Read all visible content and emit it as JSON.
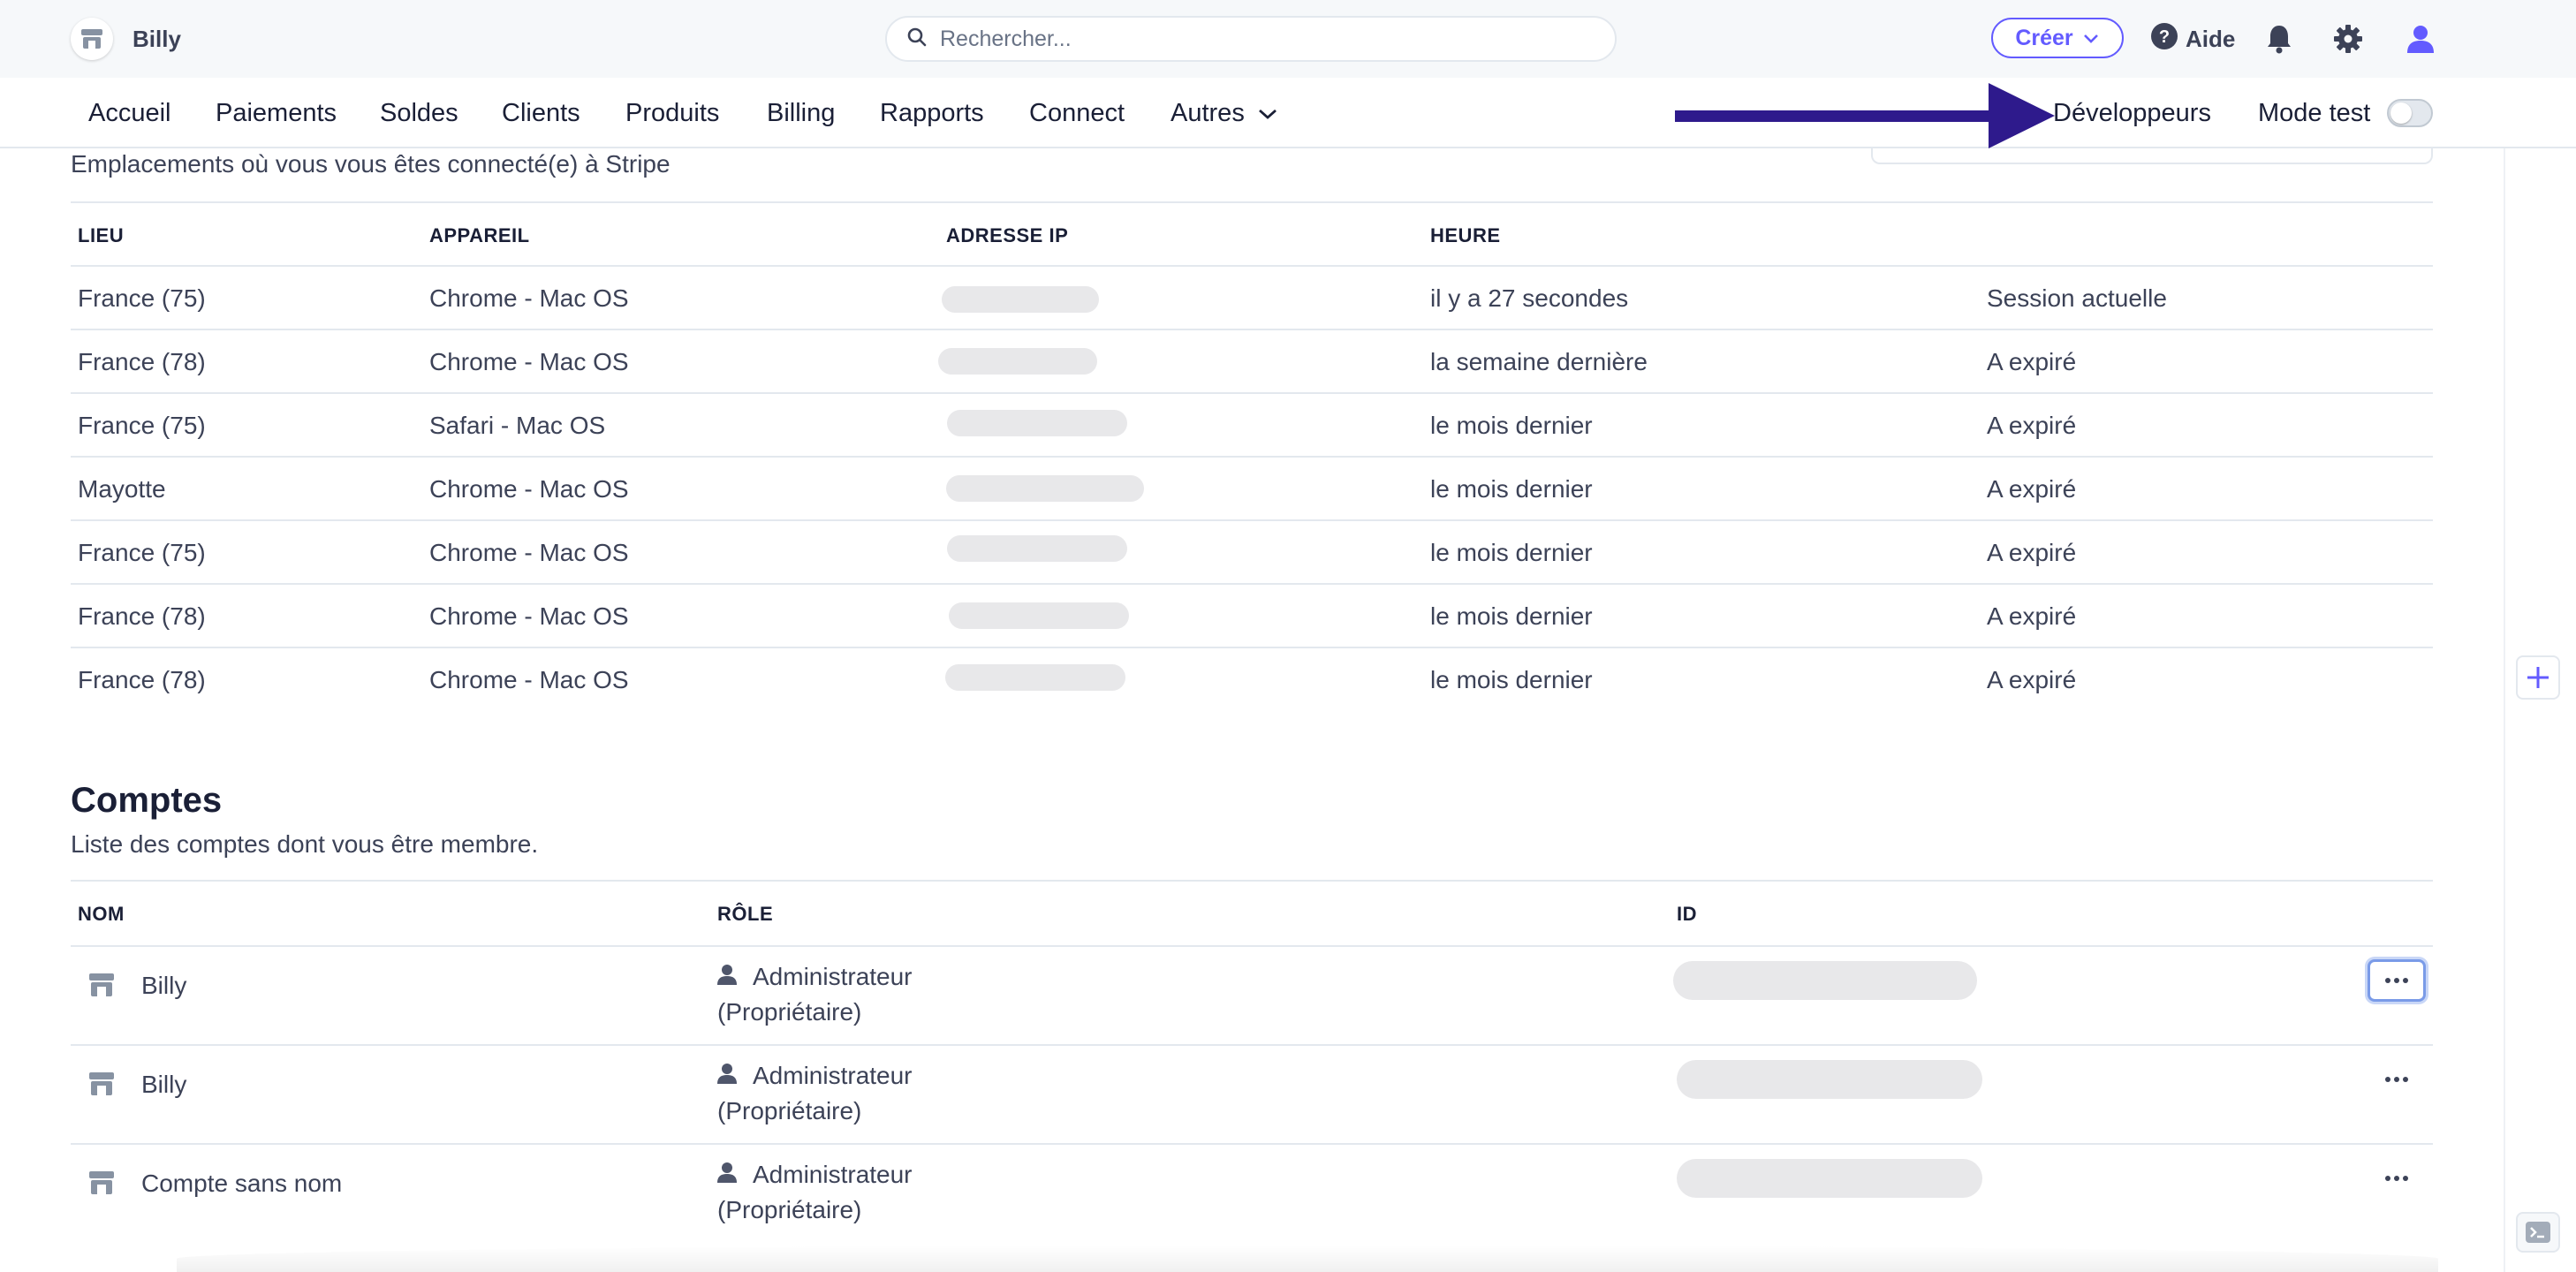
{
  "header": {
    "account_name": "Billy",
    "search_placeholder": "Rechercher...",
    "create_label": "Créer",
    "help_label": "Aide"
  },
  "nav": {
    "items": [
      "Accueil",
      "Paiements",
      "Soldes",
      "Clients",
      "Produits",
      "Billing",
      "Rapports",
      "Connect",
      "Autres"
    ],
    "developers_label": "Développeurs",
    "test_mode_label": "Mode test",
    "test_mode_on": false
  },
  "sessions": {
    "subtitle": "Emplacements où vous vous êtes connecté(e) à Stripe",
    "columns": [
      "LIEU",
      "APPAREIL",
      "ADRESSE IP",
      "HEURE"
    ],
    "rows": [
      {
        "lieu": "France (75)",
        "appareil": "Chrome - Mac OS",
        "heure": "il y a 27 secondes",
        "statut": "Session actuelle"
      },
      {
        "lieu": "France (78)",
        "appareil": "Chrome - Mac OS",
        "heure": "la semaine dernière",
        "statut": "A expiré"
      },
      {
        "lieu": "France (75)",
        "appareil": "Safari - Mac OS",
        "heure": "le mois dernier",
        "statut": "A expiré"
      },
      {
        "lieu": "Mayotte",
        "appareil": "Chrome - Mac OS",
        "heure": "le mois dernier",
        "statut": "A expiré"
      },
      {
        "lieu": "France (75)",
        "appareil": "Chrome - Mac OS",
        "heure": "le mois dernier",
        "statut": "A expiré"
      },
      {
        "lieu": "France (78)",
        "appareil": "Chrome - Mac OS",
        "heure": "le mois dernier",
        "statut": "A expiré"
      },
      {
        "lieu": "France (78)",
        "appareil": "Chrome - Mac OS",
        "heure": "le mois dernier",
        "statut": "A expiré"
      }
    ]
  },
  "accounts": {
    "title": "Comptes",
    "subtitle": "Liste des comptes dont vous être membre.",
    "columns": [
      "NOM",
      "RÔLE",
      "ID"
    ],
    "rows": [
      {
        "name": "Billy",
        "role_line1": "Administrateur",
        "role_line2": "(Propriétaire)"
      },
      {
        "name": "Billy",
        "role_line1": "Administrateur",
        "role_line2": "(Propriétaire)"
      },
      {
        "name": "Compte sans nom",
        "role_line1": "Administrateur",
        "role_line2": "(Propriétaire)"
      }
    ]
  },
  "colors": {
    "accent": "#635bff",
    "annotation_arrow": "#2e1a8c",
    "text": "#3c4257",
    "border": "#e3e8ee"
  }
}
